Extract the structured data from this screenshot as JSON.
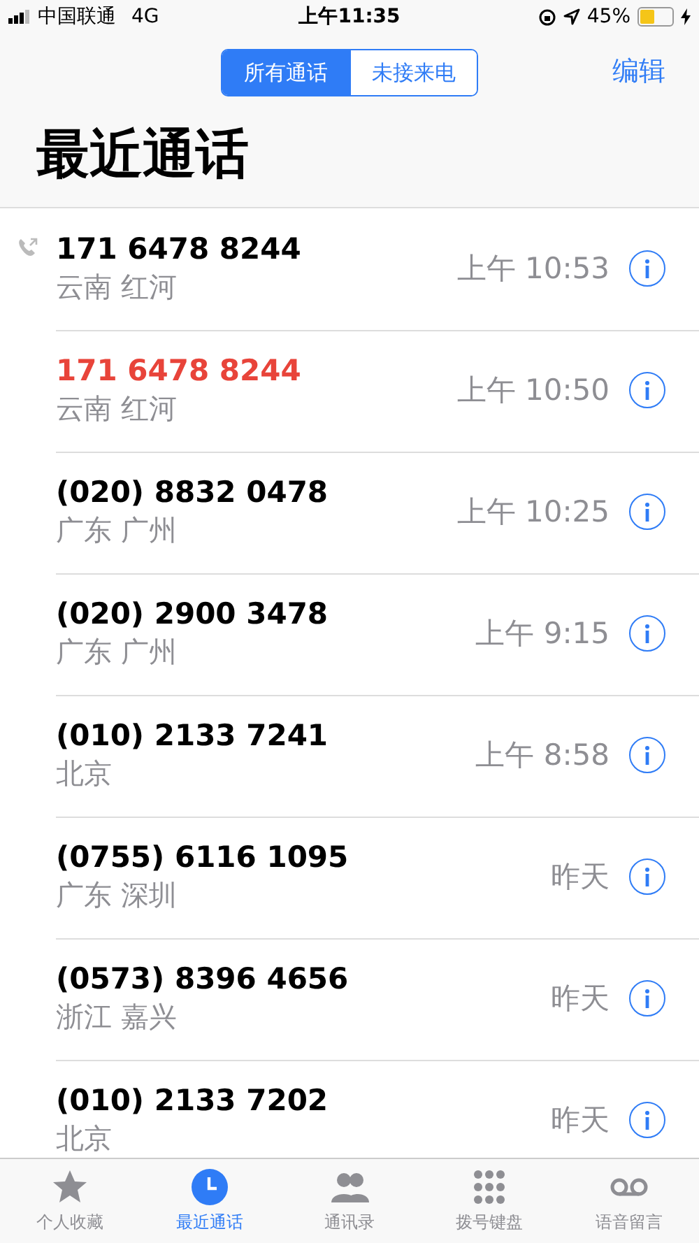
{
  "status_bar": {
    "carrier": "中国联通",
    "network": "4G",
    "time": "上午11:35",
    "battery": "45%"
  },
  "nav": {
    "segments": [
      {
        "label": "所有通话",
        "selected": true
      },
      {
        "label": "未接来电",
        "selected": false
      }
    ],
    "edit": "编辑"
  },
  "title": "最近通话",
  "calls": [
    {
      "number": "171 6478 8244",
      "location": "云南 红河",
      "time": "上午 10:53",
      "missed": false,
      "outgoing": true
    },
    {
      "number": "171 6478 8244",
      "location": "云南 红河",
      "time": "上午 10:50",
      "missed": true,
      "outgoing": false
    },
    {
      "number": "(020) 8832 0478",
      "location": "广东 广州",
      "time": "上午 10:25",
      "missed": false,
      "outgoing": false
    },
    {
      "number": "(020) 2900 3478",
      "location": "广东 广州",
      "time": "上午 9:15",
      "missed": false,
      "outgoing": false
    },
    {
      "number": "(010) 2133 7241",
      "location": "北京",
      "time": "上午 8:58",
      "missed": false,
      "outgoing": false
    },
    {
      "number": "(0755) 6116 1095",
      "location": "广东 深圳",
      "time": "昨天",
      "missed": false,
      "outgoing": false
    },
    {
      "number": "(0573) 8396 4656",
      "location": "浙江 嘉兴",
      "time": "昨天",
      "missed": false,
      "outgoing": false
    },
    {
      "number": "(010) 2133 7202",
      "location": "北京",
      "time": "昨天",
      "missed": false,
      "outgoing": false
    }
  ],
  "tab_bar": [
    {
      "label": "个人收藏",
      "selected": false
    },
    {
      "label": "最近通话",
      "selected": true
    },
    {
      "label": "通讯录",
      "selected": false
    },
    {
      "label": "拨号键盘",
      "selected": false
    },
    {
      "label": "语音留言",
      "selected": false
    }
  ]
}
